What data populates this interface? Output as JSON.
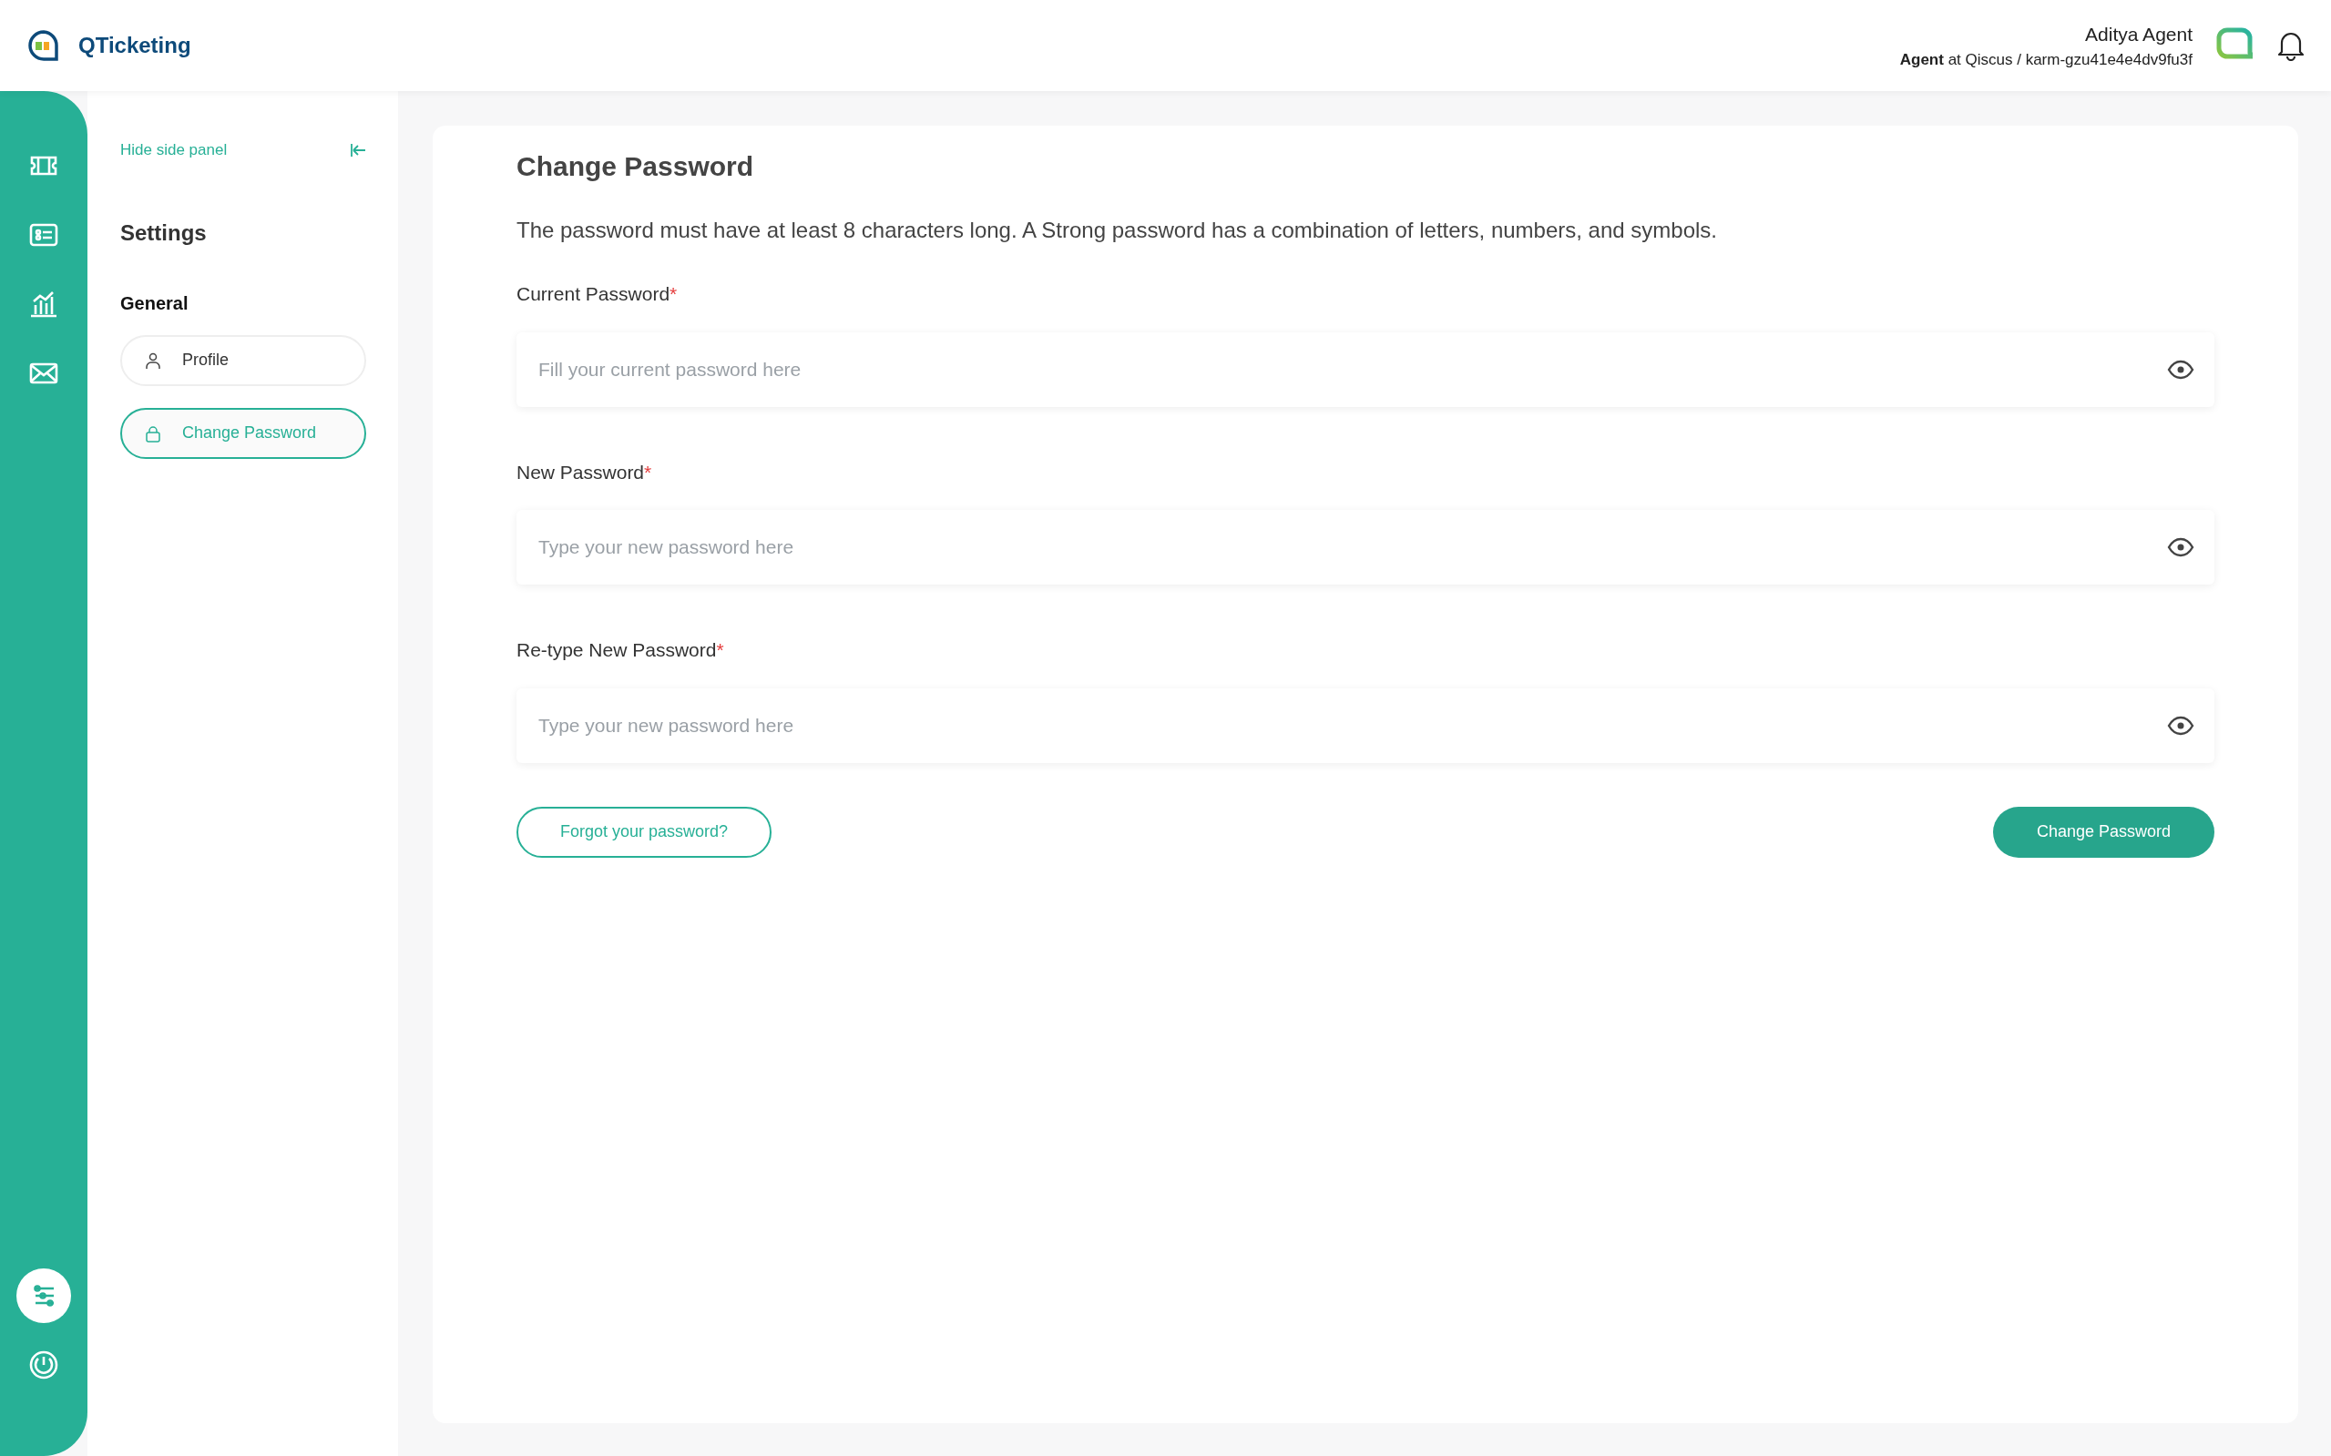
{
  "header": {
    "app_name": "QTicketing",
    "user_name": "Aditya Agent",
    "user_role": "Agent",
    "user_org": " at Qiscus / karm-gzu41e4e4dv9fu3f"
  },
  "rail": [
    {
      "kind": "ticket",
      "selected": false
    },
    {
      "kind": "contact",
      "selected": false
    },
    {
      "kind": "chart",
      "selected": false
    },
    {
      "kind": "mail",
      "selected": false
    }
  ],
  "rail_bottom": [
    {
      "kind": "settings",
      "selected": true
    },
    {
      "kind": "power",
      "selected": false
    }
  ],
  "side_panel": {
    "hide_label": "Hide side panel",
    "title": "Settings",
    "section": "General",
    "items": [
      {
        "label": "Profile",
        "kind": "person",
        "selected": false
      },
      {
        "label": "Change Password",
        "kind": "lock",
        "selected": true
      }
    ]
  },
  "form": {
    "title": "Change Password",
    "description": "The password must have at least 8 characters long. A Strong password has a combination of letters, numbers, and symbols.",
    "fields": [
      {
        "label": "Current Password",
        "required_mark": "*",
        "placeholder": "Fill your current password here"
      },
      {
        "label": "New Password",
        "required_mark": "*",
        "placeholder": "Type your new password here"
      },
      {
        "label": "Re-type New Password",
        "required_mark": "*",
        "placeholder": "Type your new password here"
      }
    ],
    "forgot_link": "Forgot your password?",
    "submit": "Change Password"
  }
}
